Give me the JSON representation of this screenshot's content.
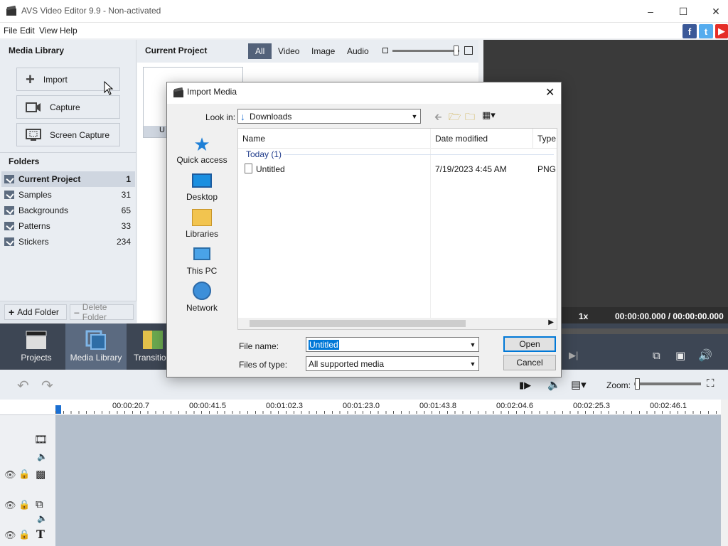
{
  "window": {
    "title": "AVS Video Editor 9.9 - Non-activated"
  },
  "menu": [
    "File",
    "Edit",
    "View",
    "Help"
  ],
  "left": {
    "media_library": "Media Library",
    "buttons": [
      "Import",
      "Capture",
      "Screen Capture"
    ],
    "folders_title": "Folders",
    "folders": [
      {
        "name": "Current Project",
        "count": "1"
      },
      {
        "name": "Samples",
        "count": "31"
      },
      {
        "name": "Backgrounds",
        "count": "65"
      },
      {
        "name": "Patterns",
        "count": "33"
      },
      {
        "name": "Stickers",
        "count": "234"
      }
    ],
    "add_folder": "Add Folder",
    "delete_folder": "Delete Folder"
  },
  "center": {
    "title": "Current Project",
    "filters": [
      "All",
      "Video",
      "Image",
      "Audio"
    ],
    "selected_filter": "All",
    "thumb_label": "U"
  },
  "preview": {
    "speed": "1x",
    "time": "00:00:00.000 / 00:00:00.000"
  },
  "dock": [
    "Projects",
    "Media Library",
    "Transition"
  ],
  "timeline": {
    "zoom_label": "Zoom:",
    "ticks": [
      "00:00:20.7",
      "00:00:41.5",
      "00:01:02.3",
      "00:01:23.0",
      "00:01:43.8",
      "00:02:04.6",
      "00:02:25.3",
      "00:02:46.1"
    ]
  },
  "dialog": {
    "title": "Import Media",
    "look_in_label": "Look in:",
    "look_in_value": "Downloads",
    "places": [
      "Quick access",
      "Desktop",
      "Libraries",
      "This PC",
      "Network"
    ],
    "columns": [
      "Name",
      "Date modified",
      "Type"
    ],
    "group": "Today (1)",
    "files": [
      {
        "name": "Untitled",
        "date": "7/19/2023 4:45 AM",
        "type": "PNG"
      }
    ],
    "file_name_label": "File name:",
    "file_name_value": "Untitled",
    "files_of_type_label": "Files of type:",
    "files_of_type_value": "All supported media",
    "open": "Open",
    "cancel": "Cancel"
  }
}
